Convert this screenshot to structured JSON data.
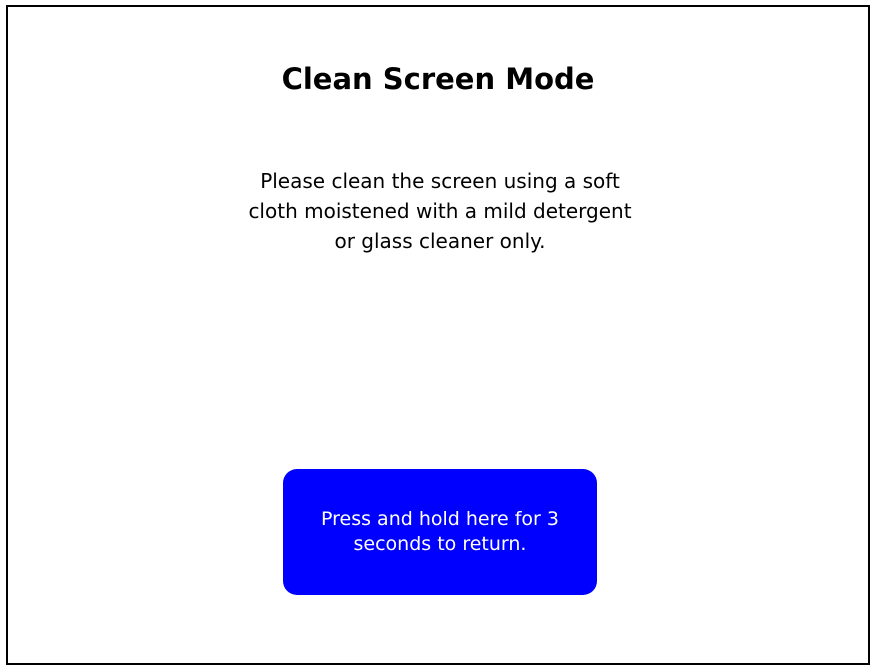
{
  "screen": {
    "title": "Clean Screen Mode",
    "instructions": "Please clean the screen using a soft cloth moistened with a mild detergent or glass cleaner only.",
    "return_button_label": "Press and hold here for 3 seconds to return."
  },
  "colors": {
    "background": "#ffffff",
    "border": "#000000",
    "button_background": "#0000ff",
    "button_text": "#ffffff"
  }
}
